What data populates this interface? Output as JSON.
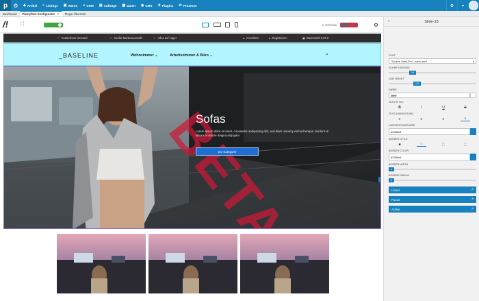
{
  "topnav": {
    "items": [
      {
        "icon": "tag-icon",
        "label": "Artikel"
      },
      {
        "icon": "list-icon",
        "label": "Listings"
      },
      {
        "icon": "box-icon",
        "label": "Waren"
      },
      {
        "icon": "users-icon",
        "label": "CRM"
      },
      {
        "icon": "cart-icon",
        "label": "Aufträge"
      },
      {
        "icon": "database-icon",
        "label": "Daten"
      },
      {
        "icon": "globe-icon",
        "label": "CMS"
      },
      {
        "icon": "plug-icon",
        "label": "Plugins"
      },
      {
        "icon": "process-icon",
        "label": "Prozesse"
      }
    ]
  },
  "tabs": [
    {
      "label": "Dashboard",
      "active": false
    },
    {
      "label": "Plentyflow-Konfigurator",
      "active": true
    },
    {
      "label": "Plugin-Übersicht",
      "active": false
    }
  ],
  "toolbar": {
    "preview_label": "Vorschau"
  },
  "store": {
    "usps": [
      "Kostenloser Versand",
      "Große Markenauswahl",
      "Alles auf Lager"
    ],
    "account": [
      "Anmelden",
      "Registrieren"
    ],
    "basket": "Warenkorb 0,00 €",
    "brand": "_BASELINE",
    "menu": [
      "Wohnzimmer",
      "Arbeitszimmer & Büro"
    ]
  },
  "hero": {
    "title": "Sofas",
    "text": "Lorem ipsum dolor sit amet, consetetur sadipscing elitr, sed diam nonumy eirmod tempor invidunt ut labore et dolore magna aliquyam",
    "button": "Zur Kategorie",
    "watermark": "BETA"
  },
  "panel": {
    "title": "Slide-18",
    "font_label": "FONT",
    "font_value": "\"Source Sans Pro\", sans-serif",
    "font_size_label": "SCHRIFTGRÖSSE",
    "font_size_value": "16",
    "line_height_label": "LINE HEIGHT",
    "line_height_value": "1.5",
    "color_label": "FARBE",
    "color_value": "#ffffff",
    "text_style_label": "TEXT STYLE",
    "text_style_icons": [
      "bold-icon",
      "italic-icon",
      "underline-icon",
      "strikethrough-icon"
    ],
    "text_align_label": "TEXT AUSRICHTUNG",
    "align_icons": [
      "align-left-icon",
      "align-center-icon",
      "align-right-icon",
      "align-justify-icon"
    ],
    "bg_label": "HINTERGRUNDFARBE",
    "bg_value": "#2780c5",
    "border_style_label": "BORDER STYLE",
    "border_color_label": "BORDER COLOR",
    "border_color_value": "#2780c5",
    "border_width_label": "BORDER WIDTH",
    "border_width_value": "1",
    "border_radius_label": "BORDER RADIUS",
    "border_radius_value": "0",
    "sections": [
      "Hover",
      "Focus",
      "Active"
    ]
  },
  "colors": {
    "accent": "#1782bd",
    "header_bg": "#b3f5ff",
    "topbar_bg": "#2e2e2e",
    "button": "#1d6fd6",
    "watermark": "#cd1937"
  }
}
